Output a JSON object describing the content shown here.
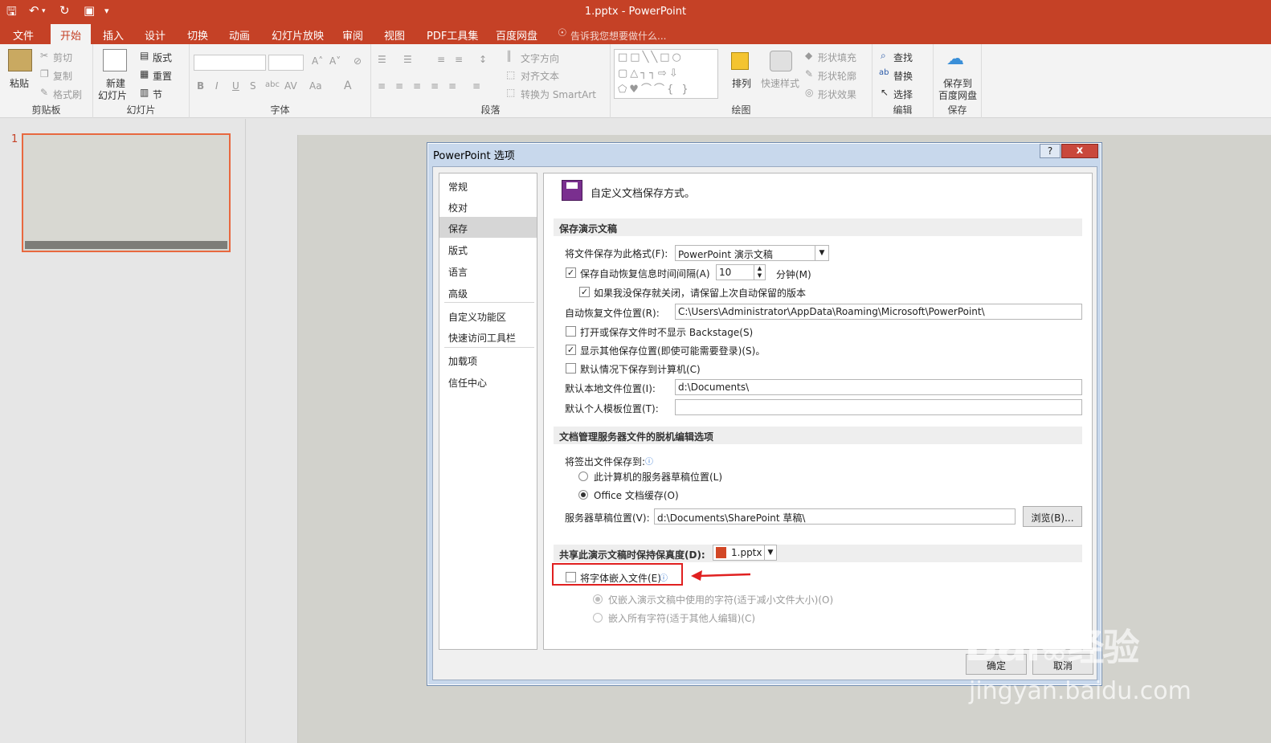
{
  "titlebar": {
    "title": "1.pptx - PowerPoint",
    "qa_icons": [
      "save-icon",
      "undo-icon",
      "redo-icon",
      "present-icon",
      "customize-icon"
    ]
  },
  "tabs": [
    "文件",
    "开始",
    "插入",
    "设计",
    "切换",
    "动画",
    "幻灯片放映",
    "审阅",
    "视图",
    "PDF工具集",
    "百度网盘"
  ],
  "tell_me": "告诉我您想要做什么...",
  "ribbon": {
    "clipboard": {
      "label": "剪贴板",
      "paste": "粘贴",
      "cut": "剪切",
      "copy": "复制",
      "format_painter": "格式刷"
    },
    "slides": {
      "label": "幻灯片",
      "new_slide_1": "新建",
      "new_slide_2": "幻灯片",
      "layout": "版式",
      "reset": "重置",
      "section": "节"
    },
    "font": {
      "label": "字体",
      "bold": "B",
      "italic": "I",
      "underline": "U",
      "shadow": "S",
      "strike": "abc",
      "spacing": "AV",
      "case": "Aa"
    },
    "paragraph": {
      "label": "段落",
      "text_direction": "文字方向",
      "align_text": "对齐文本",
      "smartart": "转换为 SmartArt"
    },
    "drawing": {
      "label": "绘图",
      "arrange": "排列",
      "quick_styles": "快速样式",
      "fill": "形状填充",
      "outline": "形状轮廓",
      "effects": "形状效果"
    },
    "editing": {
      "label": "编辑",
      "find": "查找",
      "replace": "替换",
      "select": "选择"
    },
    "save": {
      "label": "保存",
      "save_baidu_1": "保存到",
      "save_baidu_2": "百度网盘"
    }
  },
  "slide_panel": {
    "number": "1"
  },
  "dialog": {
    "title": "PowerPoint 选项",
    "help": "?",
    "close": "x",
    "nav": [
      "常规",
      "校对",
      "保存",
      "版式",
      "语言",
      "高级",
      "自定义功能区",
      "快速访问工具栏",
      "加载项",
      "信任中心"
    ],
    "selected_nav": "保存",
    "header": "自定义文档保存方式。",
    "sec1": "保存演示文稿",
    "format_label": "将文件保存为此格式(F):",
    "format_value": "PowerPoint 演示文稿",
    "autorecover_label": "保存自动恢复信息时间间隔(A)",
    "autorecover_minutes": "10",
    "minutes_label": "分钟(M)",
    "keep_last_label": "如果我没保存就关闭，请保留上次自动保留的版本",
    "autorecover_loc_label": "自动恢复文件位置(R):",
    "autorecover_loc_value": "C:\\Users\\Administrator\\AppData\\Roaming\\Microsoft\\PowerPoint\\",
    "no_backstage_label": "打开或保存文件时不显示 Backstage(S)",
    "show_other_label": "显示其他保存位置(即使可能需要登录)(S)。",
    "default_computer_label": "默认情况下保存到计算机(C)",
    "local_loc_label": "默认本地文件位置(I):",
    "local_loc_value": "d:\\Documents\\",
    "template_loc_label": "默认个人模板位置(T):",
    "template_loc_value": "",
    "sec2": "文档管理服务器文件的脱机编辑选项",
    "checkout_label": "将签出文件保存到:",
    "radio_server": "此计算机的服务器草稿位置(L)",
    "radio_cache": "Office 文档缓存(O)",
    "drafts_label": "服务器草稿位置(V):",
    "drafts_value": "d:\\Documents\\SharePoint 草稿\\",
    "browse": "浏览(B)...",
    "sec3": "共享此演示文稿时保持保真度(D):",
    "share_file": "1.pptx",
    "embed_label": "将字体嵌入文件(E)",
    "embed_used": "仅嵌入演示文稿中使用的字符(适于减小文件大小)(O)",
    "embed_all": "嵌入所有字符(适于其他人编辑)(C)",
    "ok": "确定",
    "cancel": "取消"
  },
  "watermark": {
    "brand": "Bai",
    "brand2": "经验",
    "url": "jingyan.baidu.com"
  },
  "colors": {
    "accent": "#c54126",
    "highlight": "#e02020"
  }
}
